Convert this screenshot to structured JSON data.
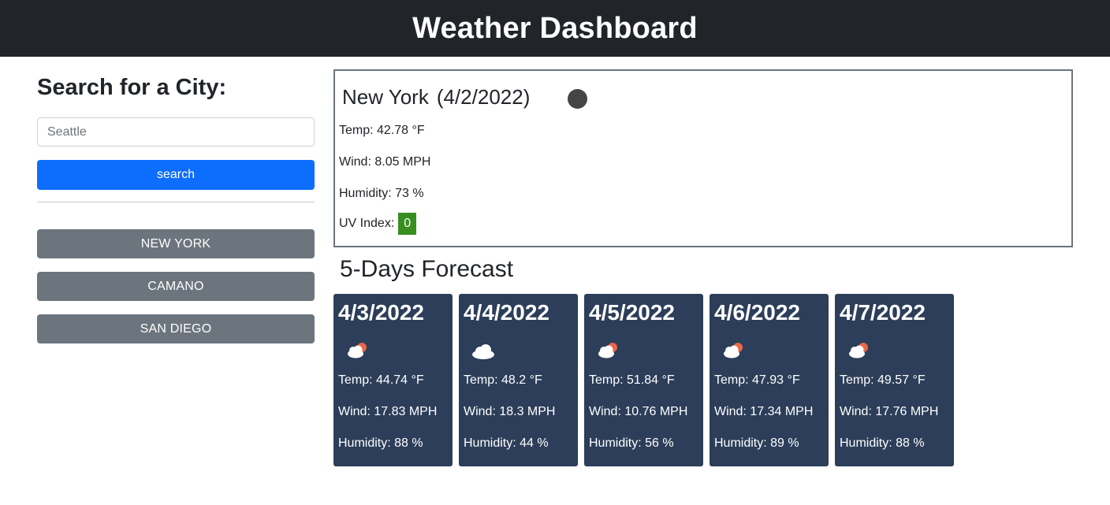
{
  "header": {
    "title": "Weather Dashboard"
  },
  "sidebar": {
    "heading": "Search for a City:",
    "search_value": "Seattle",
    "search_button": "search",
    "history": [
      "NEW YORK",
      "CAMANO",
      "SAN DIEGO"
    ]
  },
  "current": {
    "city": "New York",
    "date": "(4/2/2022)",
    "temp": "Temp: 42.78 °F",
    "wind": "Wind: 8.05 MPH",
    "humidity": "Humidity: 73 %",
    "uv_label": "UV Index:",
    "uv_value": "0",
    "uv_color": "#388e1f"
  },
  "forecast": {
    "title": "5-Days Forecast",
    "days": [
      {
        "date": "4/3/2022",
        "icon": "partly-cloudy-icon",
        "temp": "Temp: 44.74 °F",
        "wind": "Wind: 17.83 MPH",
        "humidity": "Humidity: 88 %"
      },
      {
        "date": "4/4/2022",
        "icon": "cloud-icon",
        "temp": "Temp: 48.2 °F",
        "wind": "Wind: 18.3 MPH",
        "humidity": "Humidity: 44 %"
      },
      {
        "date": "4/5/2022",
        "icon": "partly-cloudy-icon",
        "temp": "Temp: 51.84 °F",
        "wind": "Wind: 10.76 MPH",
        "humidity": "Humidity: 56 %"
      },
      {
        "date": "4/6/2022",
        "icon": "partly-cloudy-icon",
        "temp": "Temp: 47.93 °F",
        "wind": "Wind: 17.34 MPH",
        "humidity": "Humidity: 89 %"
      },
      {
        "date": "4/7/2022",
        "icon": "partly-cloudy-icon",
        "temp": "Temp: 49.57 °F",
        "wind": "Wind: 17.76 MPH",
        "humidity": "Humidity: 88 %"
      }
    ]
  }
}
